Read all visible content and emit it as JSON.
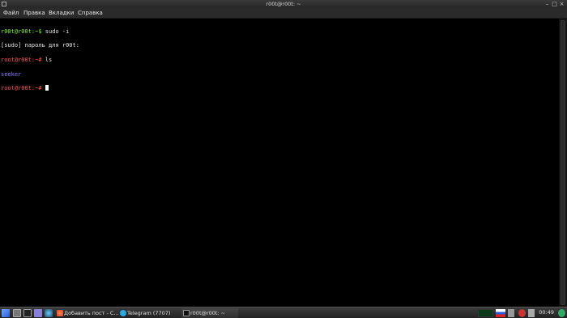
{
  "window": {
    "title": "r00t@r00t: ~"
  },
  "menu": {
    "items": [
      "Файл",
      "Правка",
      "Вкладки",
      "Справка"
    ]
  },
  "terminal": {
    "line1_prompt": "r00t@r00t:~$",
    "line1_cmd": " sudo -i",
    "line2_text": "[sudo] пароль для r00t:",
    "line3_prompt": "root@r00t:~#",
    "line3_cmd": " ls",
    "line4_output": "seeker",
    "line5_prompt": "root@r00t:~#",
    "colors": {
      "user_prompt": "#7df33a",
      "root_prompt": "#ff5454",
      "directory": "#8b7bff"
    }
  },
  "taskbar": {
    "tasks": [
      {
        "label": "Добавить пост - С...",
        "icon": "browser-icon"
      },
      {
        "label": "Telegram (7707)",
        "icon": "telegram-icon"
      },
      {
        "label": "r00t@r00t: ~",
        "icon": "terminal-icon"
      }
    ],
    "clock": "00:49"
  }
}
